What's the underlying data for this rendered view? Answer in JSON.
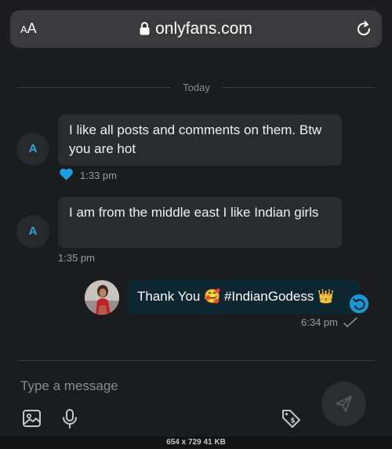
{
  "browser": {
    "text_size_label_small": "A",
    "text_size_label_large": "A",
    "url": "onlyfans.com",
    "lock_icon": "lock-icon",
    "reload_icon": "reload-icon"
  },
  "chat": {
    "day_separator": "Today",
    "messages": [
      {
        "direction": "incoming",
        "avatar_letter": "A",
        "text": "I like all posts and comments on them. Btw you are hot",
        "time": "1:33 pm",
        "liked": true
      },
      {
        "direction": "incoming",
        "avatar_letter": "A",
        "text": "I am from the middle east I like Indian girls",
        "time": "1:35 pm",
        "liked": false
      },
      {
        "direction": "outgoing",
        "text": "Thank You 🥰 #IndianGodess 👑",
        "time": "6:34 pm",
        "status": "sent"
      }
    ]
  },
  "composer": {
    "placeholder": "Type a message",
    "value": "",
    "tools": [
      "image-icon",
      "microphone-icon",
      "price-tag-icon"
    ],
    "send_icon": "send-icon"
  },
  "footer": {
    "text": "654 x 729 41 KB"
  },
  "colors": {
    "background": "#1b1c1e",
    "bubble_incoming": "#2b2c2f",
    "bubble_outgoing": "#0f2731",
    "accent": "#2aa7e0"
  }
}
